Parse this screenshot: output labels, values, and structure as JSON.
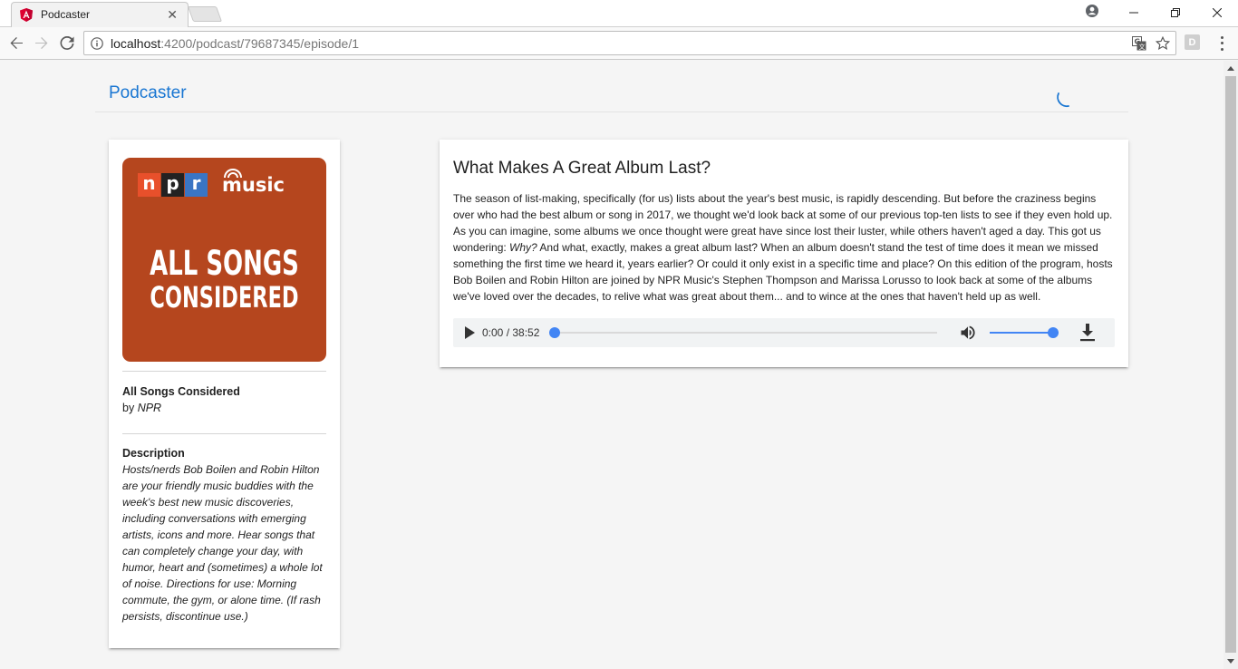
{
  "browser": {
    "tab_title": "Podcaster",
    "url_host": "localhost",
    "url_path": ":4200/podcast/79687345/episode/1",
    "extension_label": "D"
  },
  "app": {
    "brand": "Podcaster",
    "accent_color": "#1976d2"
  },
  "podcast": {
    "artwork": {
      "npr_letters": [
        "n",
        "p",
        "r"
      ],
      "npr_colors": [
        "#e8502b",
        "#222222",
        "#3a75c4"
      ],
      "music_word": "music",
      "title_line1": "ALL SONGS",
      "title_line2": "CONSIDERED",
      "background": "#b5461e"
    },
    "name": "All Songs Considered",
    "by_label": "by",
    "author": "NPR",
    "description_label": "Description",
    "description": "Hosts/nerds Bob Boilen and Robin Hilton are your friendly music buddies with the week's best new music discoveries, including conversations with emerging artists, icons and more. Hear songs that can completely change your day, with humor, heart and (sometimes) a whole lot of noise. Directions for use: Morning commute, the gym, or alone time. (If rash persists, discontinue use.)"
  },
  "episode": {
    "title": "What Makes A Great Album Last?",
    "desc_part1": "The season of list-making, specifically (for us) lists about the year's best music, is rapidly descending. But before the craziness begins over who had the best album or song in 2017, we thought we'd look back at some of our previous top-ten lists to see if they even hold up. As you can imagine, some albums we once thought were great have since lost their luster, while others haven't aged a day. This got us wondering: ",
    "desc_italic": "Why?",
    "desc_part2": " And what, exactly, makes a great album last? When an album doesn't stand the test of time does it mean we missed something the first time we heard it, years earlier? Or could it only exist in a specific time and place? On this edition of the program, hosts Bob Boilen and Robin Hilton are joined by NPR Music's Stephen Thompson and Marissa Lorusso to look back at some of the albums we've loved over the decades, to relive what was great about them... and to wince at the ones that haven't held up as well.",
    "player": {
      "time": "0:00 / 38:52",
      "progress": 0.0,
      "volume": 1.0,
      "accent_color": "#4285f4"
    }
  }
}
